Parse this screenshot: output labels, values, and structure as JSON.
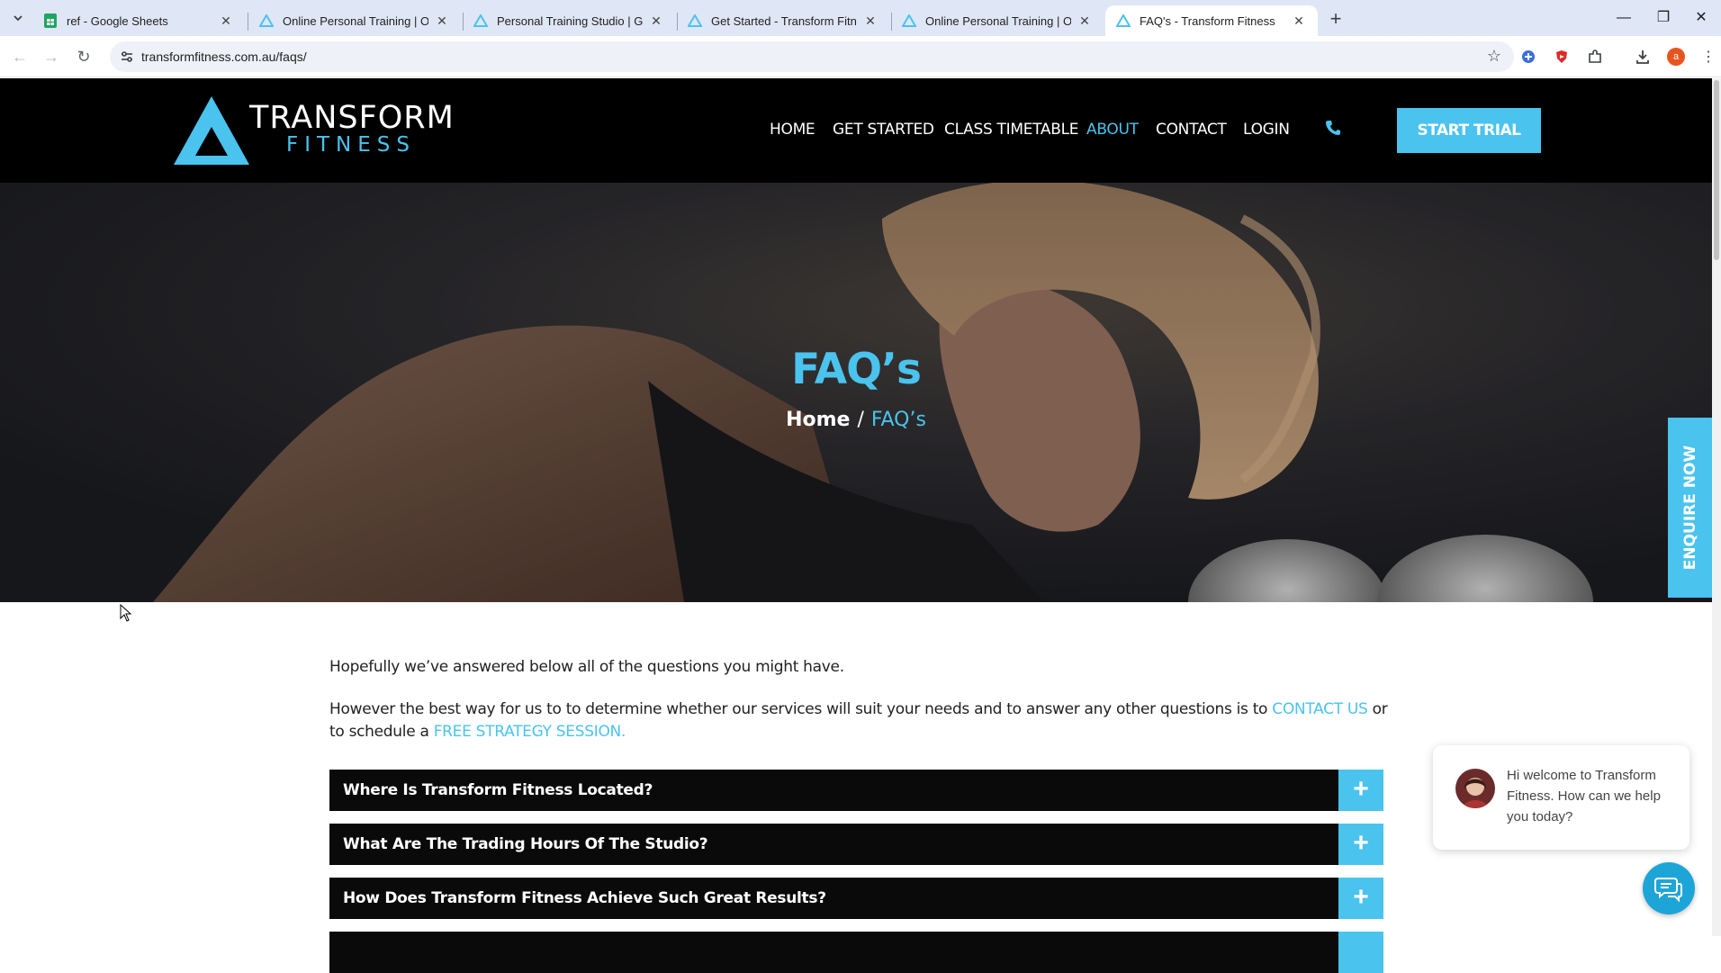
{
  "browser": {
    "tabs": [
      {
        "title": "ref - Google Sheets",
        "favicon": "sheets-icon"
      },
      {
        "title": "Online Personal Training | Onlin",
        "favicon": "transform-fitness-icon"
      },
      {
        "title": "Personal Training Studio | Grou",
        "favicon": "transform-fitness-icon"
      },
      {
        "title": "Get Started - Transform Fitness",
        "favicon": "transform-fitness-icon"
      },
      {
        "title": "Online Personal Training | Onlin",
        "favicon": "transform-fitness-icon"
      },
      {
        "title": "FAQ's - Transform Fitness",
        "favicon": "transform-fitness-icon",
        "active": true
      }
    ],
    "new_tab": "+",
    "url": "transformfitness.com.au/faqs/",
    "profile_initial": "a",
    "colors": {
      "tabstrip": "#dfe6f5",
      "accent": "#4ac3ee"
    }
  },
  "header": {
    "logo_line1": "TRANSFORM",
    "logo_line2": "FITNESS",
    "nav": {
      "home": "HOME",
      "get_started": "GET STARTED",
      "class_timetable": "CLASS TIMETABLE",
      "about": "ABOUT",
      "contact": "CONTACT",
      "login": "LOGIN"
    },
    "cta": "START TRIAL"
  },
  "hero": {
    "title": "FAQ’s",
    "breadcrumb_home": "Home",
    "breadcrumb_sep": "/",
    "breadcrumb_current": "FAQ’s"
  },
  "enquire_tab": "ENQUIRE NOW",
  "content": {
    "intro": "Hopefully we’ve answered below all of the questions you might have.",
    "para_start": "However the best way for us to to determine whether our services will suit your needs and to answer any other questions is to",
    "contact_link": "CONTACT US",
    "para_mid": "or to schedule a",
    "strategy_link": "FREE STRATEGY SESSION."
  },
  "faqs": [
    {
      "question": "Where Is Transform Fitness Located?",
      "toggle": "+"
    },
    {
      "question": "What Are The Trading Hours Of The Studio?",
      "toggle": "+"
    },
    {
      "question": "How Does Transform Fitness Achieve Such Great Results?",
      "toggle": "+"
    }
  ],
  "chat": {
    "message": "Hi welcome to Transform Fitness. How can we help you today?"
  }
}
